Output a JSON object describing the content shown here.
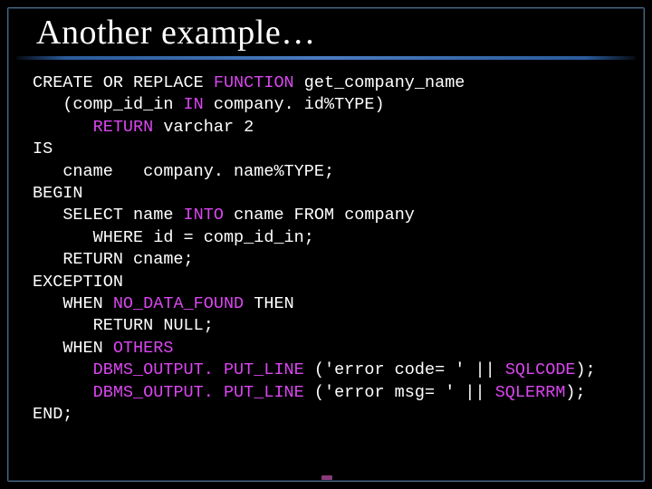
{
  "slide": {
    "title": "Another example…"
  },
  "code": {
    "lines": [
      {
        "indent": 0,
        "segments": [
          {
            "t": "CREATE OR REPLACE "
          },
          {
            "t": "FUNCTION",
            "kw": true
          },
          {
            "t": " get_company_name"
          }
        ]
      },
      {
        "indent": 1,
        "segments": [
          {
            "t": "(comp_id_in "
          },
          {
            "t": "IN",
            "kw": true
          },
          {
            "t": " company. id%TYPE)"
          }
        ]
      },
      {
        "indent": 2,
        "segments": [
          {
            "t": "RETURN",
            "kw": true
          },
          {
            "t": " varchar 2"
          }
        ]
      },
      {
        "indent": 0,
        "segments": [
          {
            "t": "IS"
          }
        ]
      },
      {
        "indent": 1,
        "segments": [
          {
            "t": "cname   company. name%TYPE;"
          }
        ]
      },
      {
        "indent": 0,
        "segments": [
          {
            "t": "BEGIN"
          }
        ]
      },
      {
        "indent": 1,
        "segments": [
          {
            "t": "SELECT name "
          },
          {
            "t": "INTO",
            "kw": true
          },
          {
            "t": " cname FROM company"
          }
        ]
      },
      {
        "indent": 2,
        "segments": [
          {
            "t": "WHERE id = comp_id_in;"
          }
        ]
      },
      {
        "indent": 1,
        "segments": [
          {
            "t": "RETURN cname;"
          }
        ]
      },
      {
        "indent": 0,
        "segments": [
          {
            "t": "EXCEPTION"
          }
        ]
      },
      {
        "indent": 1,
        "segments": [
          {
            "t": "WHEN "
          },
          {
            "t": "NO_DATA_FOUND",
            "kw": true
          },
          {
            "t": " THEN"
          }
        ]
      },
      {
        "indent": 2,
        "segments": [
          {
            "t": "RETURN NULL;"
          }
        ]
      },
      {
        "indent": 1,
        "segments": [
          {
            "t": "WHEN "
          },
          {
            "t": "OTHERS",
            "kw": true
          }
        ]
      },
      {
        "indent": 2,
        "segments": [
          {
            "t": "DBMS_OUTPUT. PUT_LINE",
            "kw": true
          },
          {
            "t": " ('error code= ' || "
          },
          {
            "t": "SQLCODE",
            "kw": true
          },
          {
            "t": ");"
          }
        ]
      },
      {
        "indent": 2,
        "segments": [
          {
            "t": "DBMS_OUTPUT. PUT_LINE",
            "kw": true
          },
          {
            "t": " ('error msg= ' || "
          },
          {
            "t": "SQLERRM",
            "kw": true
          },
          {
            "t": ");"
          }
        ]
      },
      {
        "indent": 0,
        "segments": [
          {
            "t": "END;"
          }
        ]
      }
    ],
    "indent_unit": "   "
  }
}
